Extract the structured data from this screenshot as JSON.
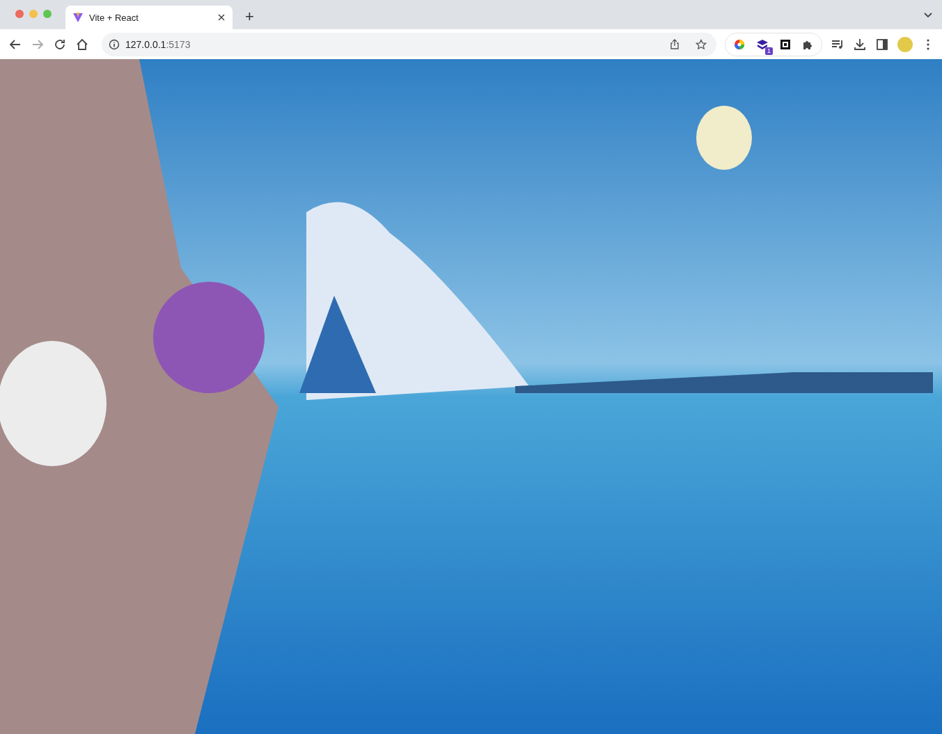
{
  "tabs": [
    {
      "title": "Vite + React",
      "selected": true
    }
  ],
  "new_tab": "+",
  "address": {
    "host": "127.0.0.1",
    "port": ":5173"
  },
  "nav": {
    "back_enabled": true,
    "forward_enabled": false
  },
  "extension_badge": "1",
  "content": {
    "kind": "painting"
  }
}
